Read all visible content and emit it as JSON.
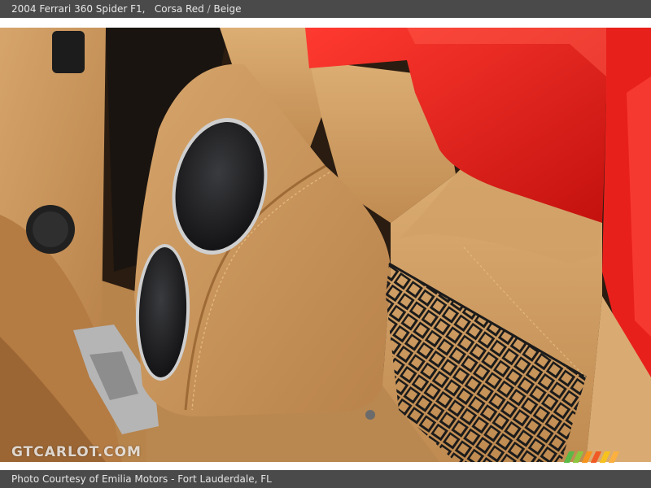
{
  "header": {
    "car": "2004 Ferrari 360 Spider F1,",
    "exterior": "Corsa Red",
    "separator": "/",
    "interior": "Beige"
  },
  "photo": {
    "description_icon": "car-interior-speaker-photo",
    "watermark": "GTCARLOT.COM",
    "colors": {
      "leather": "#c8955a",
      "carpet": "#b9864c",
      "paint": "#e8201c",
      "speaker_grille": "#1e1e20"
    }
  },
  "footer": {
    "credit": "Photo Courtesy of Emilia Motors - Fort Lauderdale, FL"
  },
  "logo_stripes": [
    "#5ab947",
    "#8cc63f",
    "#f7941d",
    "#f15a24",
    "#f7c21d",
    "#fbb040"
  ]
}
